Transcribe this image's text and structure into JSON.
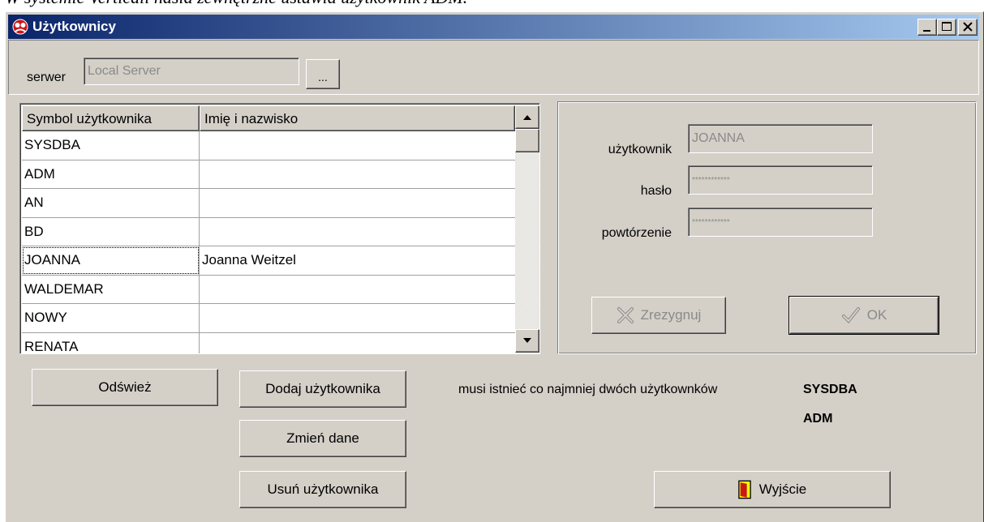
{
  "doc_caption": "W systemie Verticali hasła zewnętrzne ustawia użytkownik ADM.",
  "window": {
    "title": "Użytkownicy"
  },
  "server": {
    "label": "serwer",
    "value": "Local Server",
    "browse_label": "..."
  },
  "table": {
    "columns": [
      "Symbol użytkownika",
      "Imię i nazwisko"
    ],
    "rows": [
      {
        "symbol": "SYSDBA",
        "name": ""
      },
      {
        "symbol": "ADM",
        "name": ""
      },
      {
        "symbol": "AN",
        "name": ""
      },
      {
        "symbol": "BD",
        "name": ""
      },
      {
        "symbol": "JOANNA",
        "name": "Joanna Weitzel"
      },
      {
        "symbol": "WALDEMAR",
        "name": ""
      },
      {
        "symbol": "NOWY",
        "name": ""
      },
      {
        "symbol": "RENATA",
        "name": ""
      }
    ]
  },
  "form": {
    "user_label": "użytkownik",
    "user_value": "JOANNA",
    "password_label": "hasło",
    "password_value": "************",
    "repeat_label": "powtórzenie",
    "repeat_value": "************",
    "cancel_label": "Zrezygnuj",
    "ok_label": "OK"
  },
  "actions": {
    "refresh_label": "Odśwież",
    "add_label": "Dodaj użytkownika",
    "edit_label": "Zmień dane",
    "delete_label": "Usuń użytkownika",
    "exit_label": "Wyjście"
  },
  "note": {
    "text": "musi istnieć co najmniej dwóch użytkownków",
    "users": [
      "SYSDBA",
      "ADM"
    ]
  },
  "colors": {
    "title_start": "#0a246a",
    "title_end": "#a6caf0",
    "face": "#d4d0c8",
    "disabled_text": "#8a8a8a"
  }
}
